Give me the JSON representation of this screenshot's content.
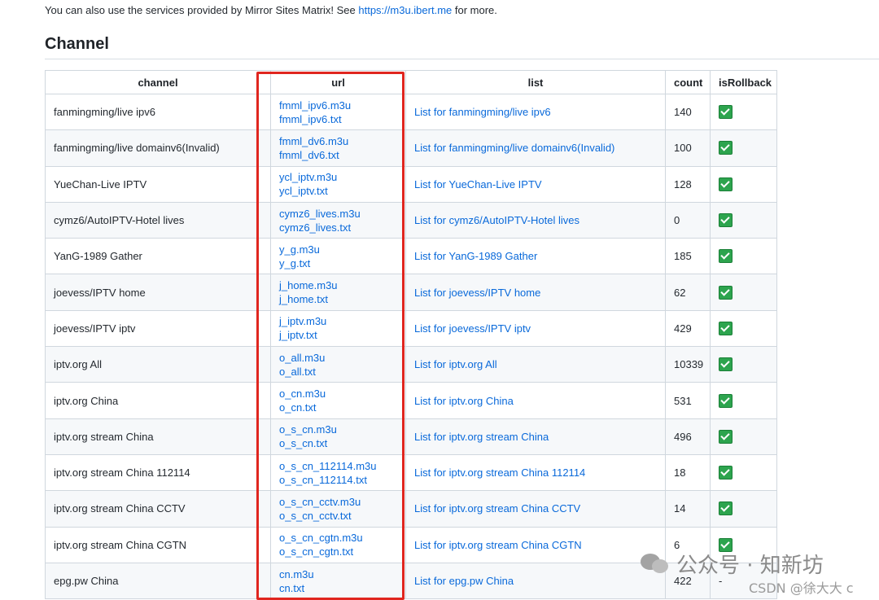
{
  "intro": {
    "text": "You can also use the services provided by Mirror Sites Matrix! See",
    "link": "https://m3u.ibert.me",
    "suffix": "for more."
  },
  "heading": "Channel",
  "table": {
    "headers": [
      "channel",
      "url",
      "list",
      "count",
      "isRollback"
    ],
    "rows": [
      {
        "channel": "fanmingming/live ipv6",
        "m3u": "fmml_ipv6.m3u",
        "txt": "fmml_ipv6.txt",
        "list": "List for fanmingming/live ipv6",
        "count": "140",
        "rollback": true
      },
      {
        "channel": "fanmingming/live domainv6(Invalid)",
        "m3u": "fmml_dv6.m3u",
        "txt": "fmml_dv6.txt",
        "list": "List for fanmingming/live domainv6(Invalid)",
        "count": "100",
        "rollback": true
      },
      {
        "channel": "YueChan-Live IPTV",
        "m3u": "ycl_iptv.m3u",
        "txt": "ycl_iptv.txt",
        "list": "List for YueChan-Live IPTV",
        "count": "128",
        "rollback": true
      },
      {
        "channel": "cymz6/AutoIPTV-Hotel lives",
        "m3u": "cymz6_lives.m3u",
        "txt": "cymz6_lives.txt",
        "list": "List for cymz6/AutoIPTV-Hotel lives",
        "count": "0",
        "rollback": true
      },
      {
        "channel": "YanG-1989 Gather",
        "m3u": "y_g.m3u",
        "txt": "y_g.txt",
        "list": "List for YanG-1989 Gather",
        "count": "185",
        "rollback": true
      },
      {
        "channel": "joevess/IPTV home",
        "m3u": "j_home.m3u",
        "txt": "j_home.txt",
        "list": "List for joevess/IPTV home",
        "count": "62",
        "rollback": true
      },
      {
        "channel": "joevess/IPTV iptv",
        "m3u": "j_iptv.m3u",
        "txt": "j_iptv.txt",
        "list": "List for joevess/IPTV iptv",
        "count": "429",
        "rollback": true
      },
      {
        "channel": "iptv.org All",
        "m3u": "o_all.m3u",
        "txt": "o_all.txt",
        "list": "List for iptv.org All",
        "count": "10339",
        "rollback": true
      },
      {
        "channel": "iptv.org China",
        "m3u": "o_cn.m3u",
        "txt": "o_cn.txt",
        "list": "List for iptv.org China",
        "count": "531",
        "rollback": true
      },
      {
        "channel": "iptv.org stream China",
        "m3u": "o_s_cn.m3u",
        "txt": "o_s_cn.txt",
        "list": "List for iptv.org stream China",
        "count": "496",
        "rollback": true
      },
      {
        "channel": "iptv.org stream China 112114",
        "m3u": "o_s_cn_112114.m3u",
        "txt": "o_s_cn_112114.txt",
        "list": "List for iptv.org stream China 112114",
        "count": "18",
        "rollback": true
      },
      {
        "channel": "iptv.org stream China CCTV",
        "m3u": "o_s_cn_cctv.m3u",
        "txt": "o_s_cn_cctv.txt",
        "list": "List for iptv.org stream China CCTV",
        "count": "14",
        "rollback": true
      },
      {
        "channel": "iptv.org stream China CGTN",
        "m3u": "o_s_cn_cgtn.m3u",
        "txt": "o_s_cn_cgtn.txt",
        "list": "List for iptv.org stream China CGTN",
        "count": "6",
        "rollback": true
      },
      {
        "channel": "epg.pw China",
        "m3u": "cn.m3u",
        "txt": "cn.txt",
        "list": "List for epg.pw China",
        "count": "422",
        "rollback": false,
        "rollback_text": "-"
      }
    ]
  },
  "watermark": {
    "text": "公众号 · 知新坊",
    "csdn": "CSDN @徐大大 c"
  },
  "colors": {
    "link": "#0969da",
    "highlight": "#e0261f",
    "check": "#2da44e"
  }
}
